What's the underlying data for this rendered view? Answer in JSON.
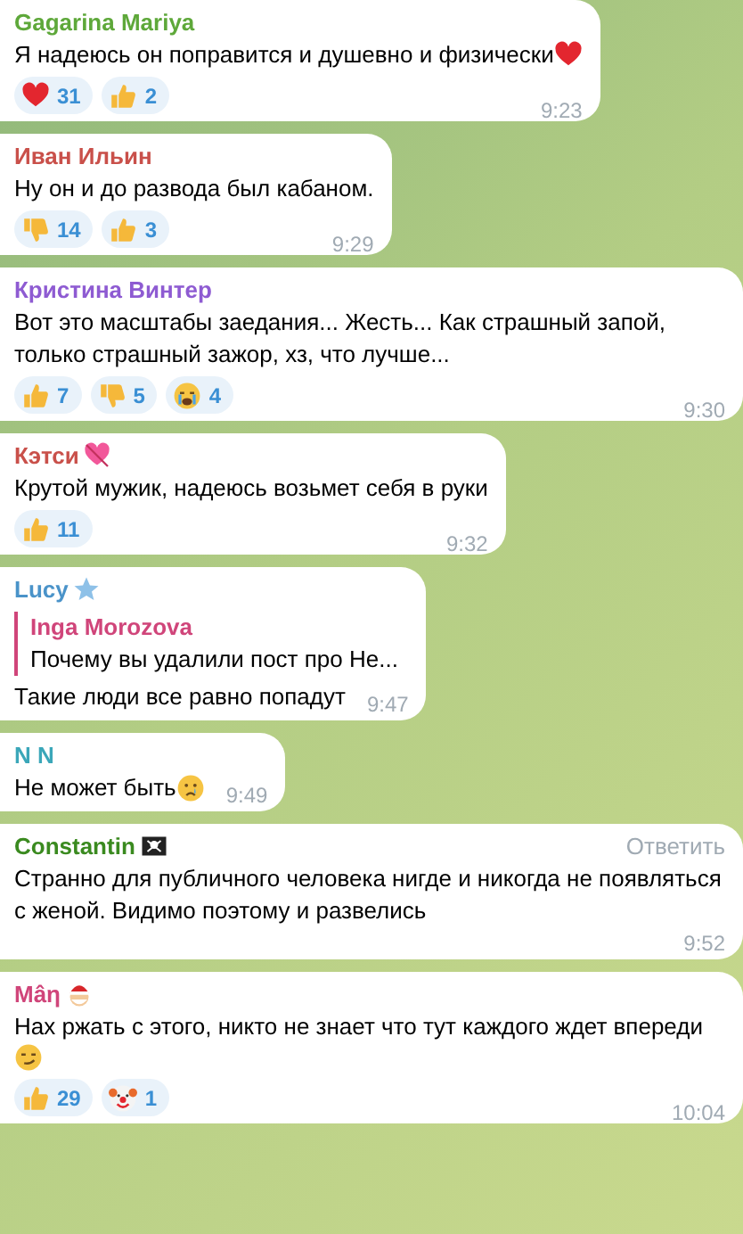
{
  "messages": [
    {
      "author": "Gagarina Mariya",
      "color": "#5ea83a",
      "text": "Я надеюсь он поправится и душевно и физически",
      "end_icon": {
        "kind": "heart"
      },
      "reactions": [
        {
          "kind": "heart",
          "count": "31"
        },
        {
          "kind": "thumbs-up",
          "count": "2"
        }
      ],
      "time": "9:23"
    },
    {
      "author": "Иван Ильин",
      "color": "#c9504a",
      "text": "Ну он и до развода был кабаном.",
      "reactions": [
        {
          "kind": "thumbs-down",
          "count": "14"
        },
        {
          "kind": "thumbs-up",
          "count": "3"
        }
      ],
      "time": "9:29"
    },
    {
      "author": "Кристина Винтер",
      "color": "#8e5bd2",
      "text": "Вот это масштабы заедания... Жесть... Как страшный запой, только страшный зажор, хз, что лучше...",
      "reactions": [
        {
          "kind": "thumbs-up",
          "count": "7"
        },
        {
          "kind": "thumbs-down",
          "count": "5"
        },
        {
          "kind": "crying",
          "count": "4"
        }
      ],
      "time": "9:30"
    },
    {
      "author": "Кэтси",
      "color": "#c9504a",
      "author_icon": {
        "kind": "heart-arrow"
      },
      "text": "Крутой мужик, надеюсь возьмет себя в руки",
      "reactions": [
        {
          "kind": "thumbs-up",
          "count": "11"
        }
      ],
      "time": "9:32"
    },
    {
      "author": "Lucy",
      "color": "#4a93c9",
      "author_icon": {
        "kind": "star"
      },
      "quote": {
        "author": "Inga Morozova",
        "text": "Почему вы удалили пост про Не..."
      },
      "text": "Такие люди все равно попадут",
      "time": "9:47"
    },
    {
      "author": "N N",
      "color": "#3ba7b9",
      "text": "Не может быть",
      "end_icon": {
        "kind": "sad"
      },
      "time": "9:49"
    },
    {
      "author": "Constantin",
      "color": "#3a8a1f",
      "author_icon": {
        "kind": "flag"
      },
      "reply_label": "Ответить",
      "text": "Странно для публичного человека нигде и никогда не появляться с женой. Видимо поэтому и развелись",
      "time": "9:52"
    },
    {
      "author": "Mâη",
      "color": "#d0457a",
      "author_icon": {
        "kind": "santa"
      },
      "text": "Нах ржать с этого, никто не знает что тут каждого ждет впереди",
      "end_icon": {
        "kind": "smirk"
      },
      "reactions": [
        {
          "kind": "thumbs-up",
          "count": "29"
        },
        {
          "kind": "clown",
          "count": "1"
        }
      ],
      "time": "10:04"
    }
  ]
}
